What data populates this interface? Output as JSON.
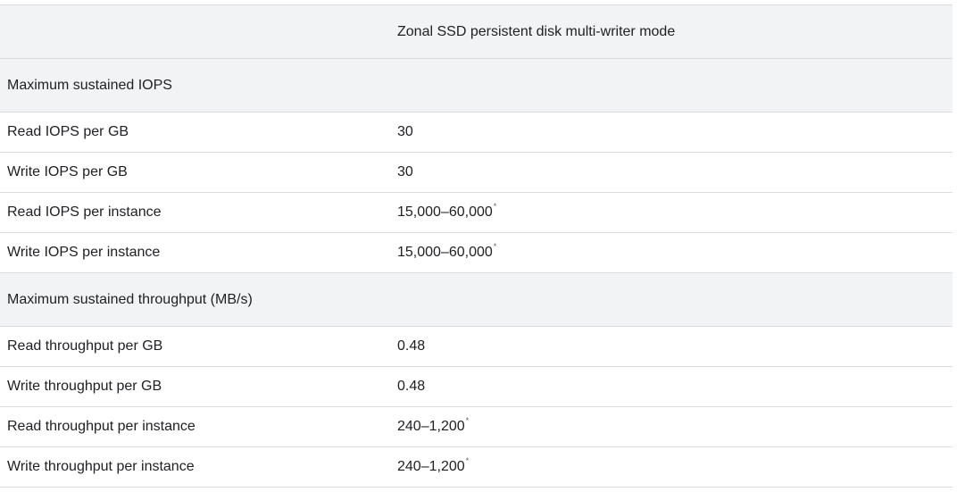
{
  "table": {
    "header": {
      "corner": "",
      "column": "Zonal SSD persistent disk multi-writer mode"
    },
    "sections": [
      {
        "title": "Maximum sustained IOPS",
        "rows": [
          {
            "label": "Read IOPS per GB",
            "value": "30",
            "note": ""
          },
          {
            "label": "Write IOPS per GB",
            "value": "30",
            "note": ""
          },
          {
            "label": "Read IOPS per instance",
            "value": "15,000–60,000",
            "note": "*"
          },
          {
            "label": "Write IOPS per instance",
            "value": "15,000–60,000",
            "note": "*"
          }
        ]
      },
      {
        "title": "Maximum sustained throughput (MB/s)",
        "rows": [
          {
            "label": "Read throughput per GB",
            "value": "0.48",
            "note": ""
          },
          {
            "label": "Write throughput per GB",
            "value": "0.48",
            "note": ""
          },
          {
            "label": "Read throughput per instance",
            "value": "240–1,200",
            "note": "*"
          },
          {
            "label": "Write throughput per instance",
            "value": "240–1,200",
            "note": "*"
          }
        ]
      }
    ]
  }
}
